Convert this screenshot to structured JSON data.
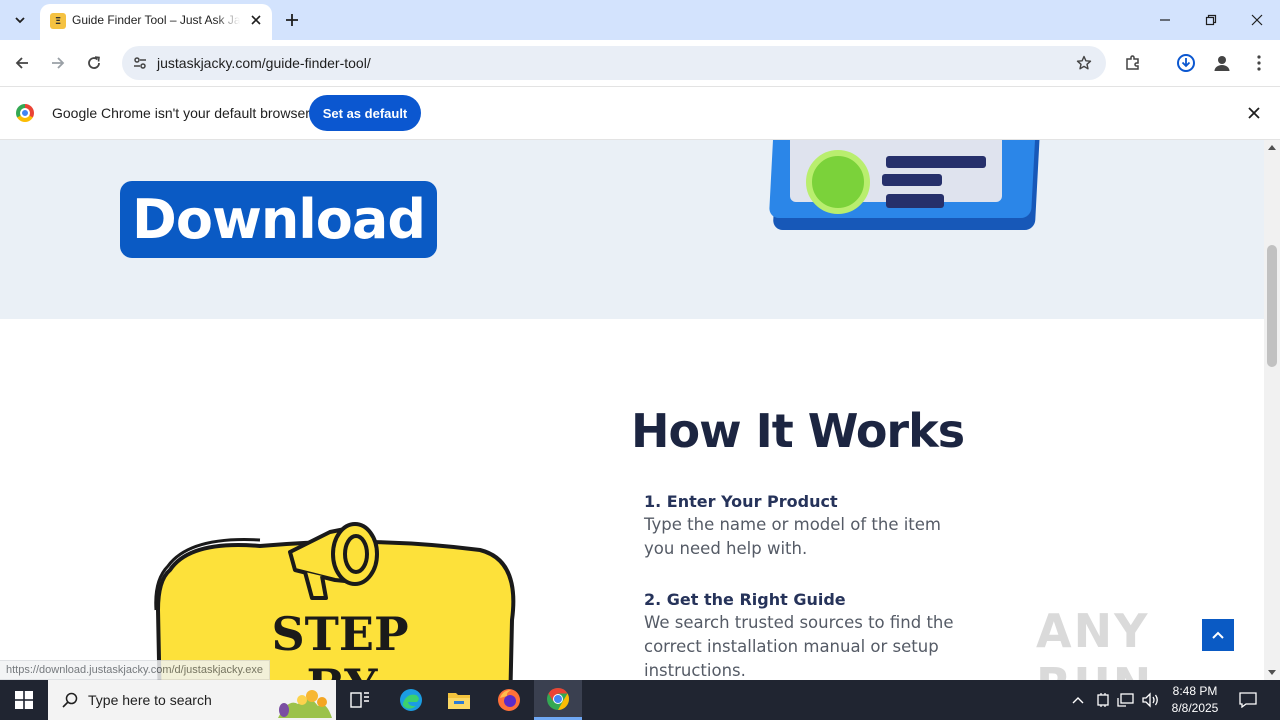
{
  "browser": {
    "tab": {
      "title": "Guide Finder Tool – Just Ask Jacky",
      "favicon_letter": "Ξ"
    },
    "url": "justaskjacky.com/guide-finder-tool/",
    "infobar": {
      "message": "Google Chrome isn't your default browser",
      "button_label": "Set as default"
    }
  },
  "page": {
    "download_label": "Download",
    "how_title": "How It Works",
    "steps": [
      {
        "heading": "1. Enter Your Product",
        "description": "Type the name or model of the item you need help with."
      },
      {
        "heading": "2. Get the Right Guide",
        "description": "We search trusted sources to find the correct installation manual or setup instructions."
      }
    ],
    "megaphone_text_line1": "STEP",
    "megaphone_text_line2": "BY",
    "status_url": "https://download.justaskjacky.com/d/justaskjacky.exe",
    "watermark": "ANY RUN"
  },
  "taskbar": {
    "search_placeholder": "Type here to search",
    "time": "8:48 PM",
    "date": "8/8/2025"
  },
  "colors": {
    "accent": "#0b57d0",
    "download_button": "#0a5ac4",
    "hero_bg": "#eaf0f6",
    "heading": "#1c2541"
  }
}
